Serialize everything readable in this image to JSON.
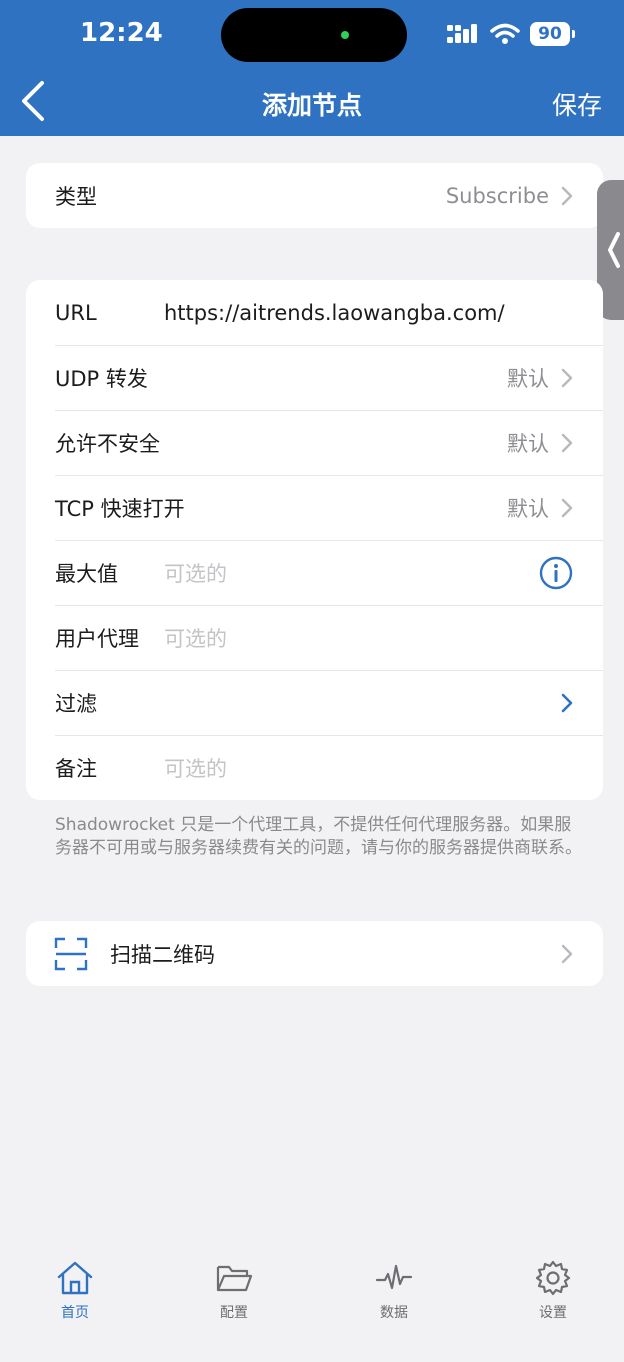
{
  "status": {
    "time": "12:24",
    "battery": "90"
  },
  "nav": {
    "title": "添加节点",
    "save": "保存"
  },
  "type_card": {
    "label": "类型",
    "value": "Subscribe"
  },
  "form": {
    "url": {
      "label": "URL",
      "value": "https://aitrends.laowangba.com/"
    },
    "udp": {
      "label": "UDP 转发",
      "value": "默认"
    },
    "insecure": {
      "label": "允许不安全",
      "value": "默认"
    },
    "tfo": {
      "label": "TCP 快速打开",
      "value": "默认"
    },
    "max": {
      "label": "最大值",
      "placeholder": "可选的"
    },
    "ua": {
      "label": "用户代理",
      "placeholder": "可选的"
    },
    "filter": {
      "label": "过滤"
    },
    "note": {
      "label": "备注",
      "placeholder": "可选的"
    }
  },
  "footer_note": "Shadowrocket 只是一个代理工具，不提供任何代理服务器。如果服务器不可用或与服务器续费有关的问题，请与你的服务器提供商联系。",
  "scan": {
    "label": "扫描二维码"
  },
  "tabs": [
    {
      "label": "首页",
      "icon": "home-icon",
      "active": true
    },
    {
      "label": "配置",
      "icon": "folder-icon",
      "active": false
    },
    {
      "label": "数据",
      "icon": "activity-icon",
      "active": false
    },
    {
      "label": "设置",
      "icon": "gear-icon",
      "active": false
    }
  ],
  "colors": {
    "accent": "#2e72c1",
    "background": "#f2f2f4",
    "secondary_text": "#8e8e93",
    "placeholder": "#c4c4c8"
  }
}
